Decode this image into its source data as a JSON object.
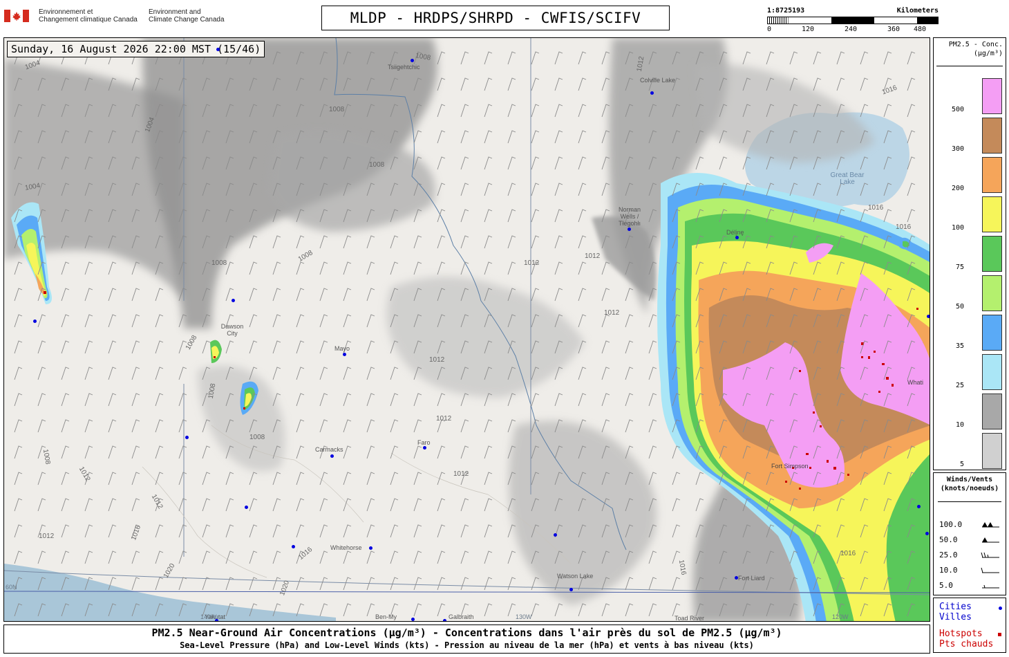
{
  "header": {
    "agency_fr": [
      "Environnement et",
      "Changement climatique Canada"
    ],
    "agency_en": [
      "Environment and",
      "Climate Change Canada"
    ],
    "title": "MLDP - HRDPS/SHRPD - CWFIS/SCIFV"
  },
  "scale": {
    "ratio": "1:8725193",
    "unit": "Kilometers",
    "ticks": [
      "0",
      "120",
      "240",
      "360",
      "480"
    ]
  },
  "map": {
    "timestamp": "Sunday, 16 August 2026 22:00 MST (15/46)",
    "cities": [
      {
        "name": "Tsiigehtchic"
      },
      {
        "name": "Colville Lake"
      },
      {
        "name": "Norman Wells / Tłegohłı"
      },
      {
        "name": "Délįnę"
      },
      {
        "name": "Dawson City"
      },
      {
        "name": "Mayo"
      },
      {
        "name": "Carmacks"
      },
      {
        "name": "Faro"
      },
      {
        "name": "Whitehorse"
      },
      {
        "name": "Watson Lake"
      },
      {
        "name": "Fort Liard"
      },
      {
        "name": "Toad River"
      },
      {
        "name": "Yakutat"
      },
      {
        "name": "Ben-My"
      },
      {
        "name": "Galbraith"
      },
      {
        "name": "Fort Simpson"
      },
      {
        "name": "Whati"
      }
    ],
    "water_labels": [
      "Great Bear Lake"
    ],
    "graticule_labels": [
      "60N",
      "140W",
      "130W",
      "120W"
    ],
    "isobar_labels": [
      "1004",
      "1008",
      "1012",
      "1016",
      "1020"
    ]
  },
  "legend_pm": {
    "title": [
      "PM2.5 - Conc.",
      "(µg/m³)"
    ],
    "classes": [
      {
        "label": "500",
        "color": "#f49ef4"
      },
      {
        "label": "300",
        "color": "#c48a5a"
      },
      {
        "label": "200",
        "color": "#f5a55a"
      },
      {
        "label": "100",
        "color": "#f6f55a"
      },
      {
        "label": "75",
        "color": "#5ac85a"
      },
      {
        "label": "50",
        "color": "#b4f06e"
      },
      {
        "label": "35",
        "color": "#5aaaf6"
      },
      {
        "label": "25",
        "color": "#aae6f6"
      },
      {
        "label": "10",
        "color": "#a8a8a8"
      },
      {
        "label": "5",
        "color": "#d0d0d0"
      }
    ]
  },
  "legend_wind": {
    "title": [
      "Winds/Vents",
      "(knots/noeuds)"
    ],
    "speeds": [
      "100.0",
      "50.0",
      "25.0",
      "10.0",
      "5.0"
    ]
  },
  "legend_points": {
    "cities": [
      "Cities",
      "Villes"
    ],
    "hotspots": [
      "Hotspots",
      "Pts chauds"
    ],
    "city_color": "#0000e0",
    "hotspot_color": "#cc0000"
  },
  "footer": {
    "line1": "PM2.5 Near-Ground Air Concentrations (µg/m³) - Concentrations dans l'air près du sol de PM2.5 (µg/m³)",
    "line2": "Sea-Level Pressure (hPa) and Low-Level Winds (kts) - Pression au niveau de la mer (hPa) et vents à bas niveau (kts)"
  }
}
